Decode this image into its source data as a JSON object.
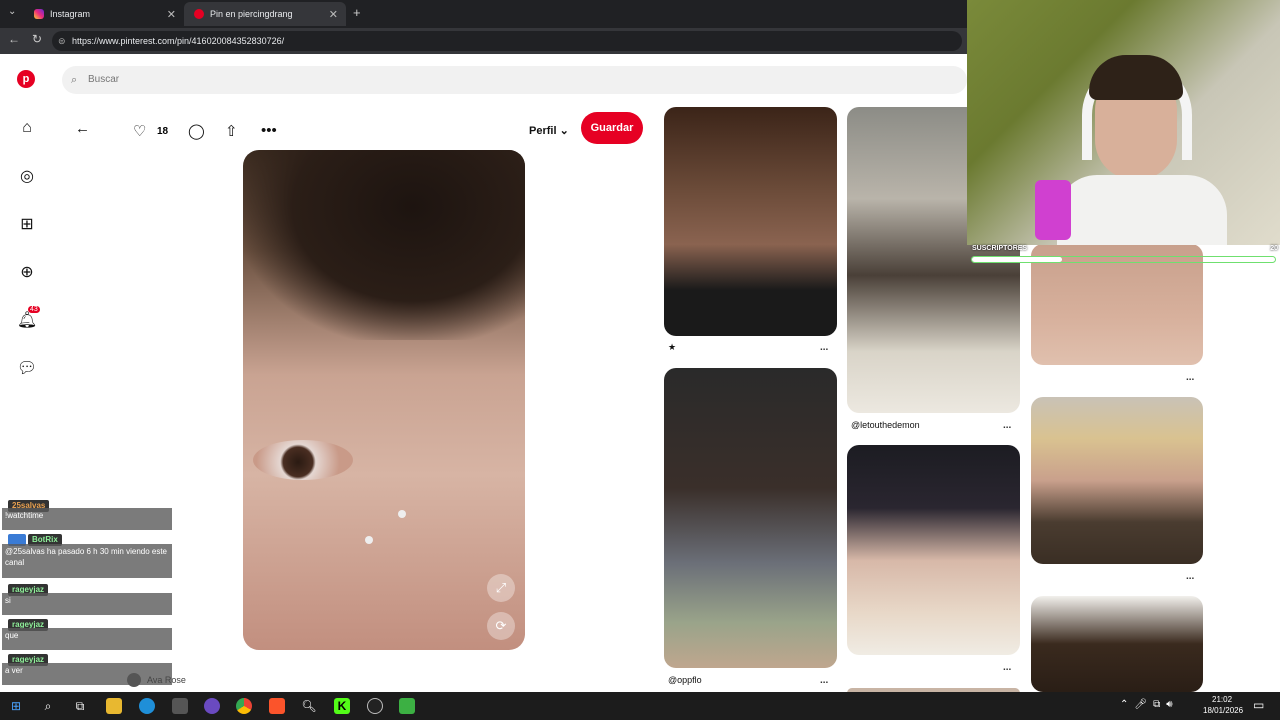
{
  "browser": {
    "tabs": [
      {
        "label": "Instagram",
        "active": false
      },
      {
        "label": "Pin en piercingdrang",
        "active": true
      }
    ],
    "url": "https://www.pinterest.com/pin/416020084352830726/"
  },
  "search": {
    "placeholder": "Buscar"
  },
  "sidebar": {
    "badge": "43"
  },
  "pin": {
    "likes": "18",
    "profile_label": "Perfil",
    "save_label": "Guardar"
  },
  "grid": {
    "captions": [
      "★",
      "@letouthedemon",
      "@oppflo"
    ],
    "more_label": "..."
  },
  "chat": {
    "messages": [
      {
        "user": "25salvas",
        "text": "!watchtime"
      },
      {
        "user": "BotRix",
        "text": "@25salvas ha pasado 6 h 30 min viendo este canal"
      },
      {
        "user": "rageyjaz",
        "text": "si"
      },
      {
        "user": "rageyjaz",
        "text": "que"
      },
      {
        "user": "rageyjaz",
        "text": "a ver"
      }
    ],
    "viewer": "Ava Rose"
  },
  "overlay": {
    "subs_label": "SUSCRIPTORES",
    "subs_value": "20"
  },
  "taskbar": {
    "time": "21:02",
    "date": "18/01/2026"
  },
  "colors": {
    "brand": "#e60023",
    "tabbar": "#202124"
  }
}
